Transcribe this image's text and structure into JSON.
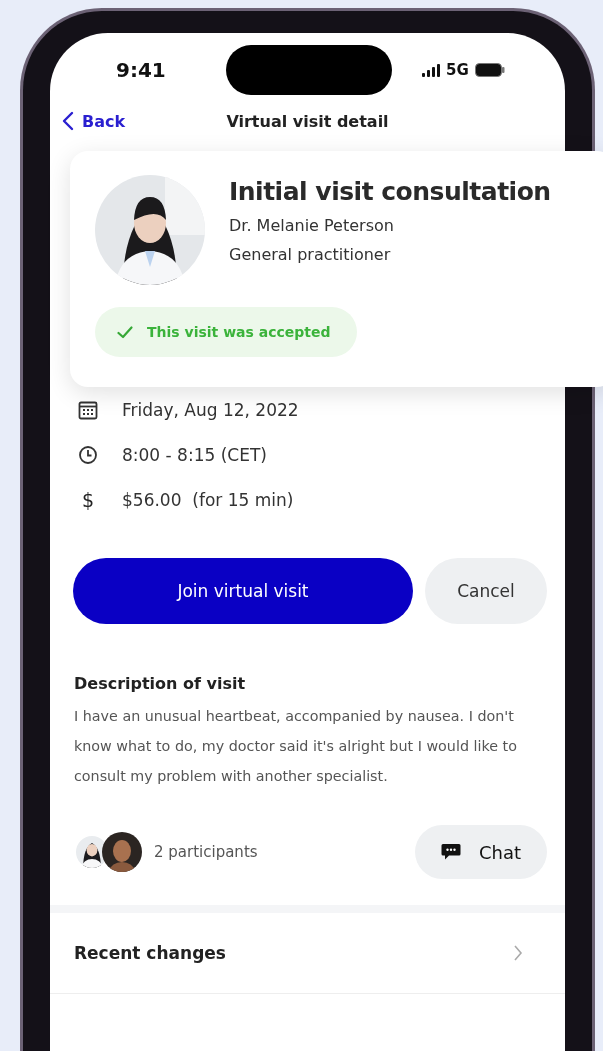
{
  "status_bar": {
    "time": "9:41",
    "network": "5G"
  },
  "nav": {
    "back": "Back",
    "title": "Virtual visit detail"
  },
  "visit": {
    "title": "Initial visit consultation",
    "doctor": "Dr. Melanie Peterson",
    "specialty": "General practitioner",
    "status": "This visit was accepted",
    "accepted": true
  },
  "details": [
    {
      "kind": "date",
      "text": "Friday, Aug 12, 2022"
    },
    {
      "kind": "time",
      "text": "8:00 - 8:15 (CET)"
    },
    {
      "kind": "price",
      "icon": "$",
      "text": "$56.00  (for 15 min)"
    }
  ],
  "actions": {
    "primary": "Join virtual visit",
    "secondary": "Cancel"
  },
  "description": {
    "heading": "Description of visit",
    "text": "I have an unusual heartbeat, accompanied by nausea. I don't know what to do, my doctor said it's alright but I would like to consult my problem with another specialist."
  },
  "participants": {
    "label": "2 participants",
    "chat": "Chat"
  },
  "recent_changes": {
    "label": "Recent changes"
  }
}
